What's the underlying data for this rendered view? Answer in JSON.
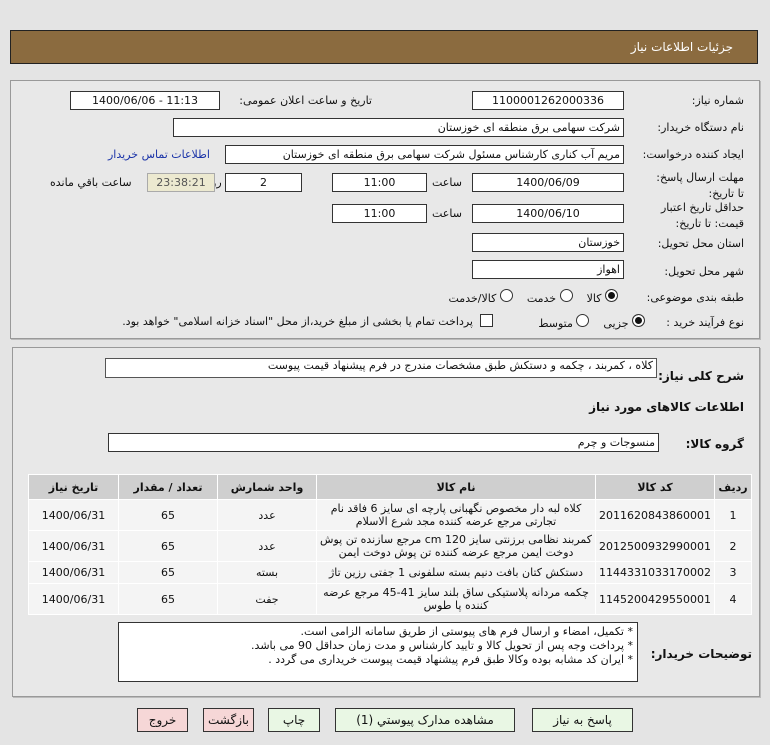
{
  "header": {
    "title": "جزئیات اطلاعات نیاز"
  },
  "form": {
    "need_number_label": "شماره نیاز:",
    "need_number": "1100001262000336",
    "announce_label": "تاریخ و ساعت اعلان عمومی:",
    "announce_value": "1400/06/06 - 11:13",
    "buyer_label": "نام دستگاه خریدار:",
    "buyer": "شرکت سهامی برق منطقه ای خوزستان",
    "creator_label": "ایجاد کننده درخواست:",
    "creator": "مریم آب کناری کارشناس مسئول شرکت سهامی برق منطقه ای خوزستان",
    "contact_link": "اطلاعات تماس خریدار",
    "deadline_label": "مهلت ارسال پاسخ: تا تاریخ:",
    "deadline_date": "1400/06/09",
    "time_label": "ساعت",
    "deadline_time": "11:00",
    "days": "2",
    "days_label": "روز و",
    "remaining": "23:38:21",
    "remaining_label": "ساعت باقي مانده",
    "validity_label": "حداقل تاریخ اعتبار قیمت: تا تاریخ:",
    "validity_date": "1400/06/10",
    "validity_time": "11:00",
    "province_label": "استان محل تحویل:",
    "province": "خوزستان",
    "city_label": "شهر محل تحویل:",
    "city": "اهواز",
    "category_label": "طبقه بندی موضوعی:",
    "category_options": [
      "کالا",
      "خدمت",
      "کالا/خدمت"
    ],
    "category_selected": "کالا",
    "process_label": "نوع فرآیند خرید :",
    "process_options": [
      "جزیی",
      "متوسط"
    ],
    "process_selected": "جزیی",
    "payment_note": "پرداخت تمام یا بخشی از مبلغ خرید،از محل \"اسناد خزانه اسلامی\" خواهد بود."
  },
  "details": {
    "summary_label": "شرح کلی نیاز:",
    "summary": "کلاه ، کمربند ، چکمه  و دستکش طبق مشخصات مندرج در فرم پیشنهاد قیمت پیوست",
    "items_title": "اطلاعات کالاهای مورد نیاز",
    "group_label": "گروه کالا:",
    "group": "منسوجات و چرم",
    "columns": [
      "ردیف",
      "کد کالا",
      "نام کالا",
      "واحد شمارش",
      "تعداد / مقدار",
      "تاریخ نیاز"
    ],
    "rows": [
      [
        "1",
        "2011620843860001",
        "کلاه لبه دار مخصوص نگهبانی پارچه ای سایز 6 فاقد نام تجارتی مرجع عرضه کننده مجد شرع الاسلام",
        "عدد",
        "65",
        "1400/06/31"
      ],
      [
        "2",
        "2012500932990001",
        "کمربند نظامی برزنتی سایز 120 cm مرجع سازنده تن پوش دوخت ایمن مرجع عرضه کننده تن پوش دوخت ایمن",
        "عدد",
        "65",
        "1400/06/31"
      ],
      [
        "3",
        "1144331033170002",
        "دستکش کتان بافت دنیم بسته سلفونی 1 جفتی رزین تاژ",
        "بسته",
        "65",
        "1400/06/31"
      ],
      [
        "4",
        "1145200429550001",
        "چکمه مردانه پلاستیکی ساق بلند سایز 41-45 مرجع عرضه کننده پا طوس",
        "جفت",
        "65",
        "1400/06/31"
      ]
    ],
    "notes_label": "توضیحات خریدار:",
    "notes": [
      "* تکمیل، امضاء و ارسال فرم های پیوستی از طریق سامانه الزامی است.",
      "* پرداخت وجه پس از تحویل کالا و تایید کارشناس و مدت زمان حداقل 90  می باشد.",
      "* ایران کد مشابه بوده وکالا طبق فرم پیشنهاد قیمت پیوست خریداری می گردد ."
    ]
  },
  "buttons": {
    "reply": "پاسخ به نیاز",
    "attachments": "مشاهده مدارک پیوستي (1)",
    "print": "چاپ",
    "back": "بازگشت",
    "exit": "خروج"
  }
}
